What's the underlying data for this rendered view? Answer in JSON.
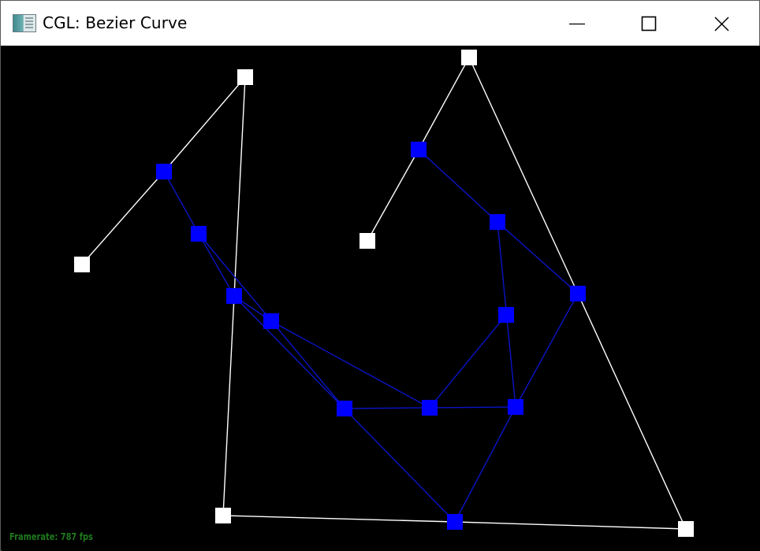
{
  "window": {
    "title": "CGL: Bezier Curve",
    "icon": "app-window-icon",
    "controls": [
      {
        "name": "minimize",
        "icon": "minimize-icon"
      },
      {
        "name": "maximize",
        "icon": "maximize-icon"
      },
      {
        "name": "close",
        "icon": "close-icon"
      }
    ]
  },
  "status": {
    "framerate_label": "Framerate: 787 fps",
    "framerate_value": 787
  },
  "colors": {
    "background": "#000000",
    "control_points": "#ffffff",
    "intermediate_points": "#0000ff",
    "intermediate_lines": "#0000cc",
    "framerate_text": "#1e7a1e"
  }
}
